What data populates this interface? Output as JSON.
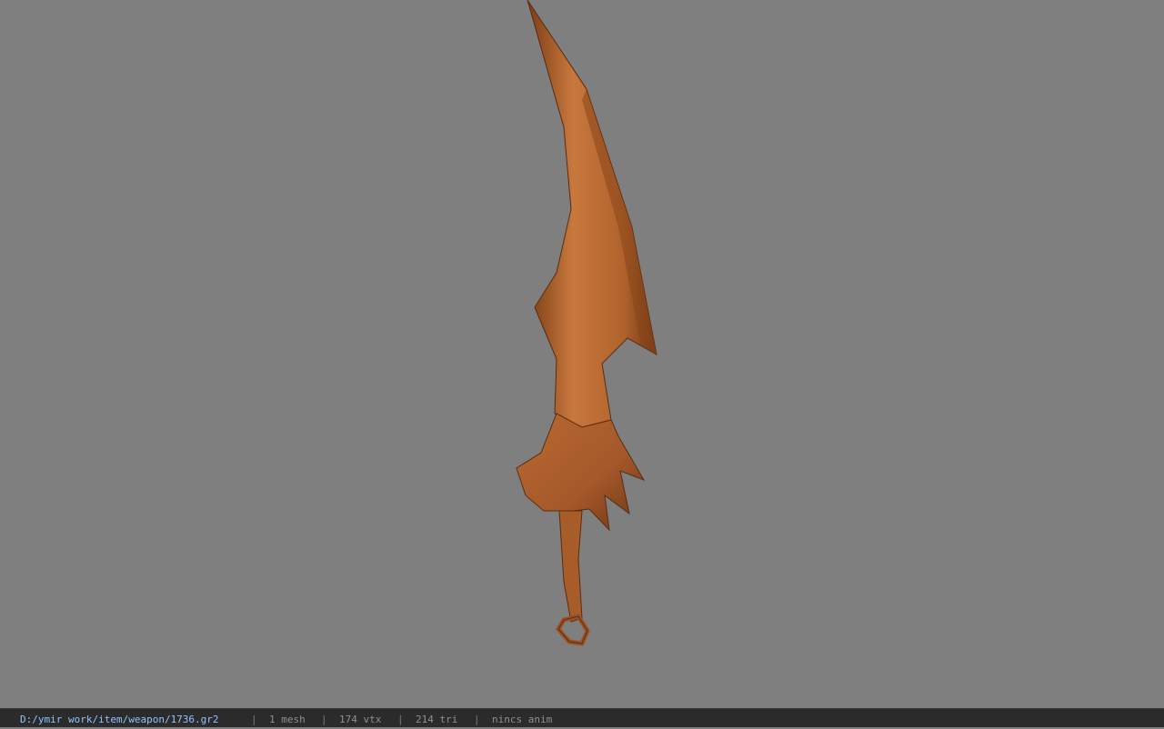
{
  "viewport": {
    "background_color": "#7f7f7f",
    "model": {
      "kind": "weapon",
      "color_primary": "#b0622c",
      "color_light": "#c8783c",
      "color_shadow": "#6a3515"
    }
  },
  "statusbar": {
    "file_path": "D:/ymir work/item/weapon/1736.gr2",
    "separator": "|",
    "mesh_count": "1 mesh",
    "vertex_count": "174 vtx",
    "triangle_count": "214 tri",
    "anim_status": "nincs anim",
    "path_color": "#8fc3ff"
  }
}
